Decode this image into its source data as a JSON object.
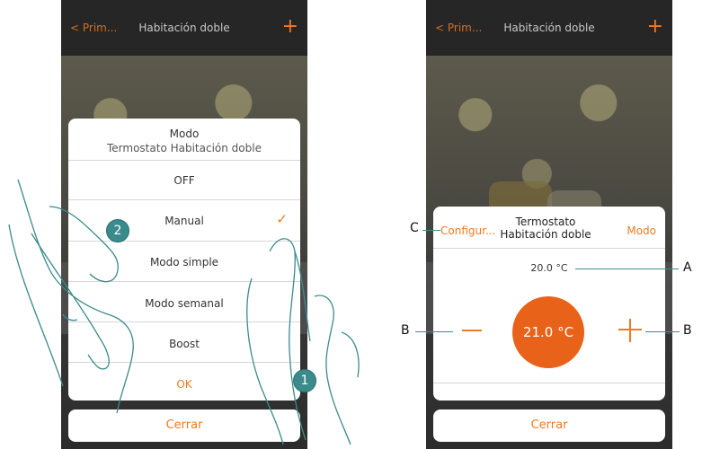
{
  "left_phone": {
    "back_label": "< Prim...",
    "title": "Habitación doble",
    "plus_icon": "+",
    "dialog": {
      "title": "Modo",
      "subtitle": "Termostato Habitación doble",
      "options": [
        "OFF",
        "Manual",
        "Modo simple",
        "Modo semanal",
        "Boost"
      ],
      "selected": "Manual",
      "ok_label": "OK"
    },
    "close_label": "Cerrar"
  },
  "right_phone": {
    "back_label": "< Prim...",
    "title": "Habitación doble",
    "plus_icon": "+",
    "panel": {
      "configure_label": "Configur...",
      "thermostat_title": "Termostato Habitación doble",
      "mode_label": "Modo",
      "measured_temp": "20.0 °C",
      "setpoint_temp": "21.0 °C"
    },
    "close_label": "Cerrar"
  },
  "badges": {
    "step1": "1",
    "step2": "2"
  },
  "callouts": {
    "a": "A",
    "b_left": "B",
    "b_right": "B",
    "c": "C"
  },
  "colors": {
    "accent": "#f07a22",
    "badge": "#3b8b8c",
    "circle": "#e8621a"
  }
}
